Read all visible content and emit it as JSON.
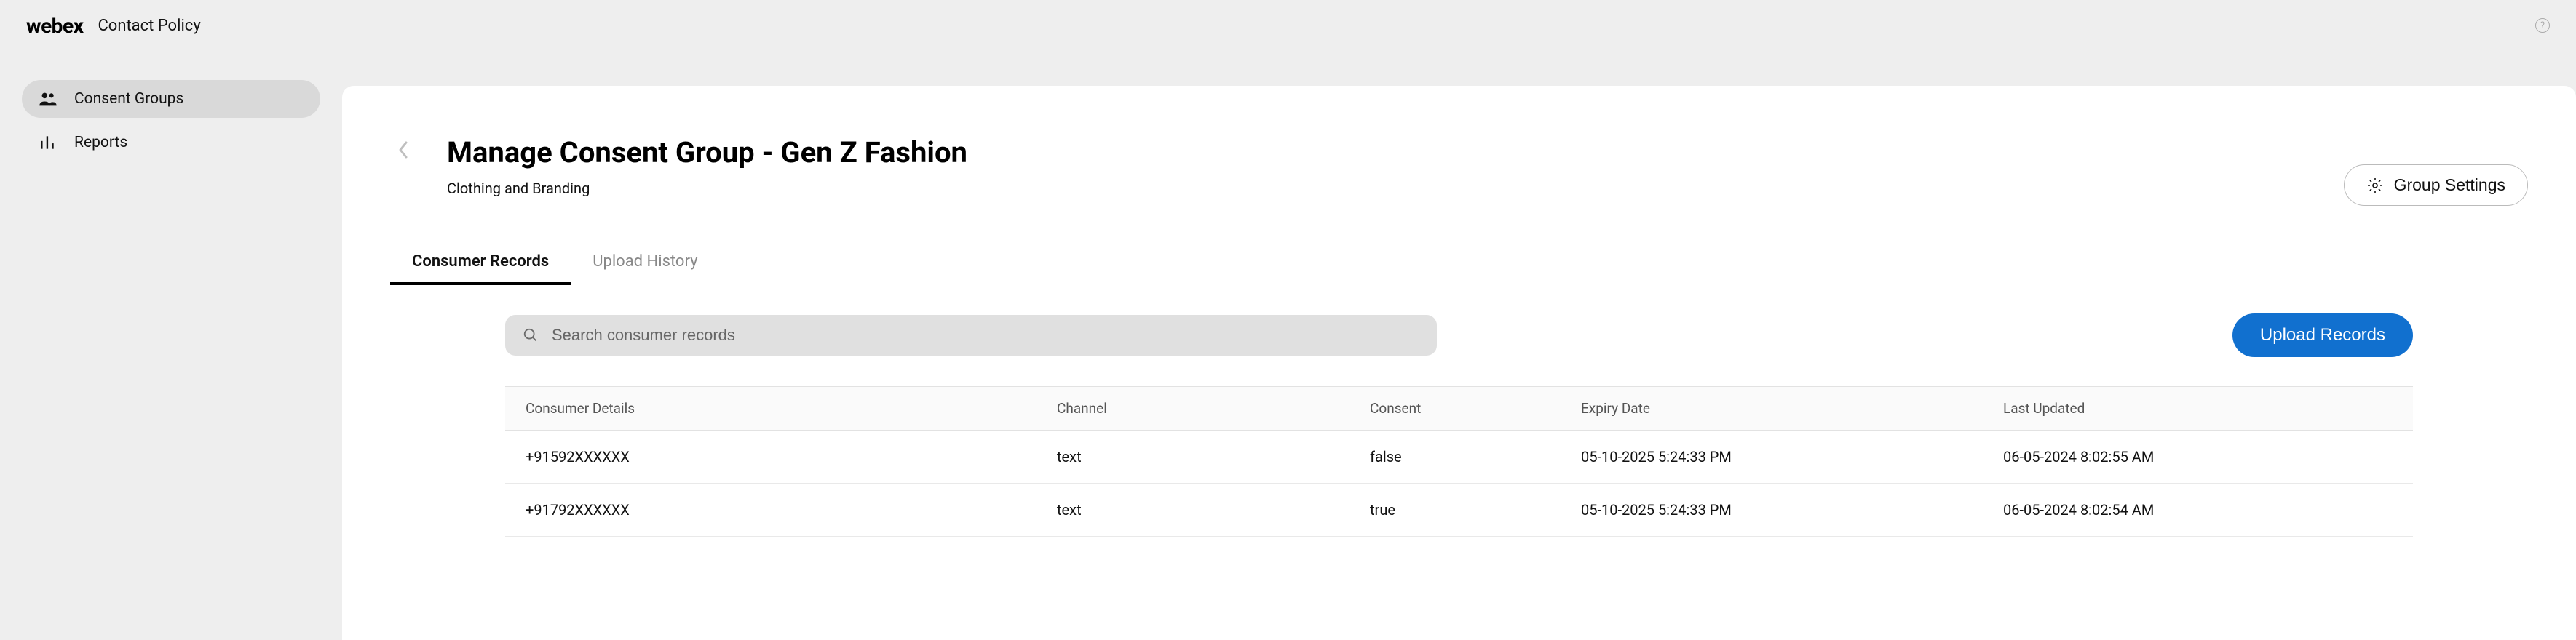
{
  "header": {
    "logo_prefix": "web",
    "logo_suffix": "ex",
    "subtitle": "Contact Policy"
  },
  "sidebar": {
    "items": [
      {
        "label": "Consent Groups",
        "active": true
      },
      {
        "label": "Reports",
        "active": false
      }
    ]
  },
  "page": {
    "title": "Manage Consent Group - Gen Z Fashion",
    "subtitle": "Clothing and Branding",
    "group_settings_label": "Group Settings"
  },
  "tabs": [
    {
      "label": "Consumer Records",
      "active": true
    },
    {
      "label": "Upload History",
      "active": false
    }
  ],
  "toolbar": {
    "search_placeholder": "Search consumer records",
    "upload_label": "Upload Records"
  },
  "table": {
    "columns": {
      "consumer": "Consumer Details",
      "channel": "Channel",
      "consent": "Consent",
      "expiry": "Expiry Date",
      "updated": "Last Updated"
    },
    "rows": [
      {
        "consumer": "+91592XXXXXX",
        "channel": "text",
        "consent": "false",
        "expiry": "05-10-2025 5:24:33 PM",
        "updated": "06-05-2024 8:02:55 AM"
      },
      {
        "consumer": "+91792XXXXXX",
        "channel": "text",
        "consent": "true",
        "expiry": "05-10-2025 5:24:33 PM",
        "updated": "06-05-2024 8:02:54 AM"
      }
    ]
  }
}
